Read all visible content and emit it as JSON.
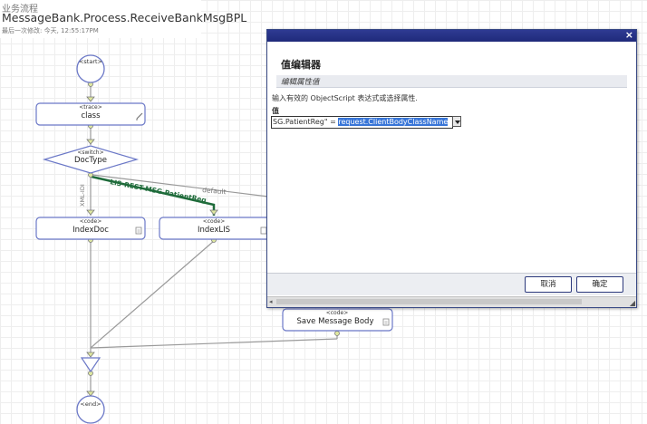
{
  "header": {
    "category": "业务流程",
    "title": "MessageBank.Process.ReceiveBankMsgBPL",
    "last_modified": "最后一次修改: 今天, 12:55:17PM"
  },
  "diagram": {
    "start": "<start>",
    "end": "<end>",
    "trace": {
      "type": "<trace>",
      "name": "class"
    },
    "switch": {
      "type": "<switch>",
      "name": "DocType"
    },
    "code_indexdoc": {
      "type": "<code>",
      "name": "IndexDoc"
    },
    "code_indexlis": {
      "type": "<code>",
      "name": "IndexLIS"
    },
    "code_save": {
      "type": "<code>",
      "name": "Save Message Body"
    },
    "edges": {
      "lis": "LIS-REST-MSG.PatientReg",
      "default": "default",
      "xml": "XML-IDI"
    }
  },
  "dialog": {
    "title": "值编辑器",
    "subtitle": "编辑属性值",
    "instruction": "输入有效的 ObjectScript 表达式或选择属性.",
    "value_label": "值",
    "input_prefix": "SG.PatientReg\" = ",
    "input_selected": "request.ClientBodyClassName",
    "cancel_label": "取消",
    "ok_label": "确定",
    "close_glyph": "×",
    "colors": {
      "titlebar": "#1f2a7a",
      "selection": "#3875d7",
      "lis_edge": "#1e6b3a"
    }
  }
}
